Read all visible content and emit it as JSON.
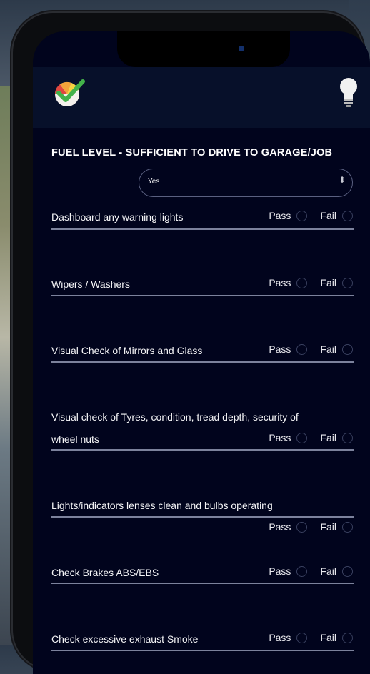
{
  "header": {
    "logo_icon": "check-logo-icon",
    "hint_icon": "lightbulb-icon"
  },
  "fuel": {
    "title": "FUEL LEVEL - SUFFICIENT TO DRIVE TO GARAGE/JOB",
    "selected": "Yes"
  },
  "options": {
    "pass": "Pass",
    "fail": "Fail"
  },
  "checks": [
    {
      "label": "Dashboard any warning lights"
    },
    {
      "label": "Wipers / Washers"
    },
    {
      "label": "Visual Check of Mirrors and Glass"
    },
    {
      "label_line1": "Visual check of Tyres, condition, tread depth, security of",
      "label_line2": "wheel nuts"
    },
    {
      "label": "Lights/indicators lenses clean and bulbs operating"
    },
    {
      "label": "Check Brakes ABS/EBS"
    },
    {
      "label": "Check excessive exhaust Smoke"
    }
  ],
  "colors": {
    "screen_bg": "#01041d",
    "header_bg": "#07102a",
    "divider": "#7c829c"
  }
}
